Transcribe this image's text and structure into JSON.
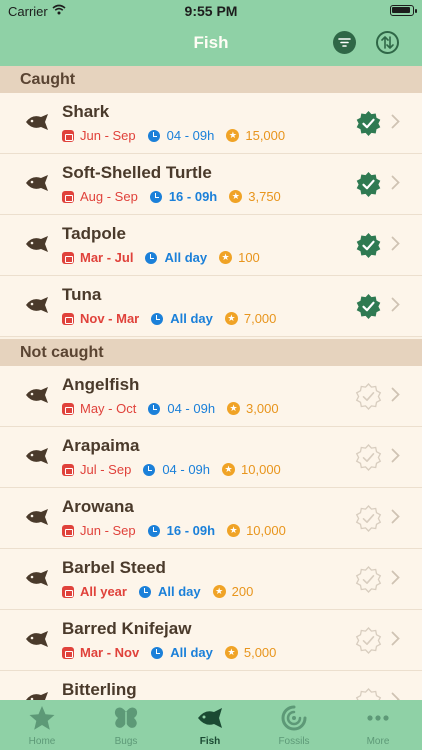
{
  "status_bar": {
    "carrier": "Carrier",
    "time": "9:55 PM"
  },
  "header": {
    "title": "Fish"
  },
  "colors": {
    "header_bg": "#8fd1a6",
    "section_bg": "#e6d3be",
    "months": "#e0423b",
    "hours": "#1b80d9",
    "price": "#e8951d",
    "caught_badge": "#2f7a52"
  },
  "sections": [
    {
      "title": "Caught",
      "items": [
        {
          "name": "Shark",
          "months": "Jun - Sep",
          "hours": "04 - 09h",
          "price": "15,000",
          "caught": true
        },
        {
          "name": "Soft-Shelled Turtle",
          "months": "Aug - Sep",
          "hours": "16 - 09h",
          "price": "3,750",
          "caught": true
        },
        {
          "name": "Tadpole",
          "months": "Mar - Jul",
          "hours": "All day",
          "price": "100",
          "caught": true
        },
        {
          "name": "Tuna",
          "months": "Nov - Mar",
          "hours": "All day",
          "price": "7,000",
          "caught": true
        }
      ]
    },
    {
      "title": "Not caught",
      "items": [
        {
          "name": "Angelfish",
          "months": "May - Oct",
          "hours": "04 - 09h",
          "price": "3,000",
          "caught": false
        },
        {
          "name": "Arapaima",
          "months": "Jul - Sep",
          "hours": "04 - 09h",
          "price": "10,000",
          "caught": false
        },
        {
          "name": "Arowana",
          "months": "Jun - Sep",
          "hours": "16 - 09h",
          "price": "10,000",
          "caught": false
        },
        {
          "name": "Barbel Steed",
          "months": "All year",
          "hours": "All day",
          "price": "200",
          "caught": false
        },
        {
          "name": "Barred Knifejaw",
          "months": "Mar - Nov",
          "hours": "All day",
          "price": "5,000",
          "caught": false
        },
        {
          "name": "Bitterling",
          "caught": false
        }
      ]
    }
  ],
  "tabbar": {
    "items": [
      {
        "label": "Home",
        "icon": "star-icon"
      },
      {
        "label": "Bugs",
        "icon": "butterfly-icon"
      },
      {
        "label": "Fish",
        "icon": "fish-icon",
        "active": true
      },
      {
        "label": "Fossils",
        "icon": "fossil-icon"
      },
      {
        "label": "More",
        "icon": "more-icon"
      }
    ]
  }
}
